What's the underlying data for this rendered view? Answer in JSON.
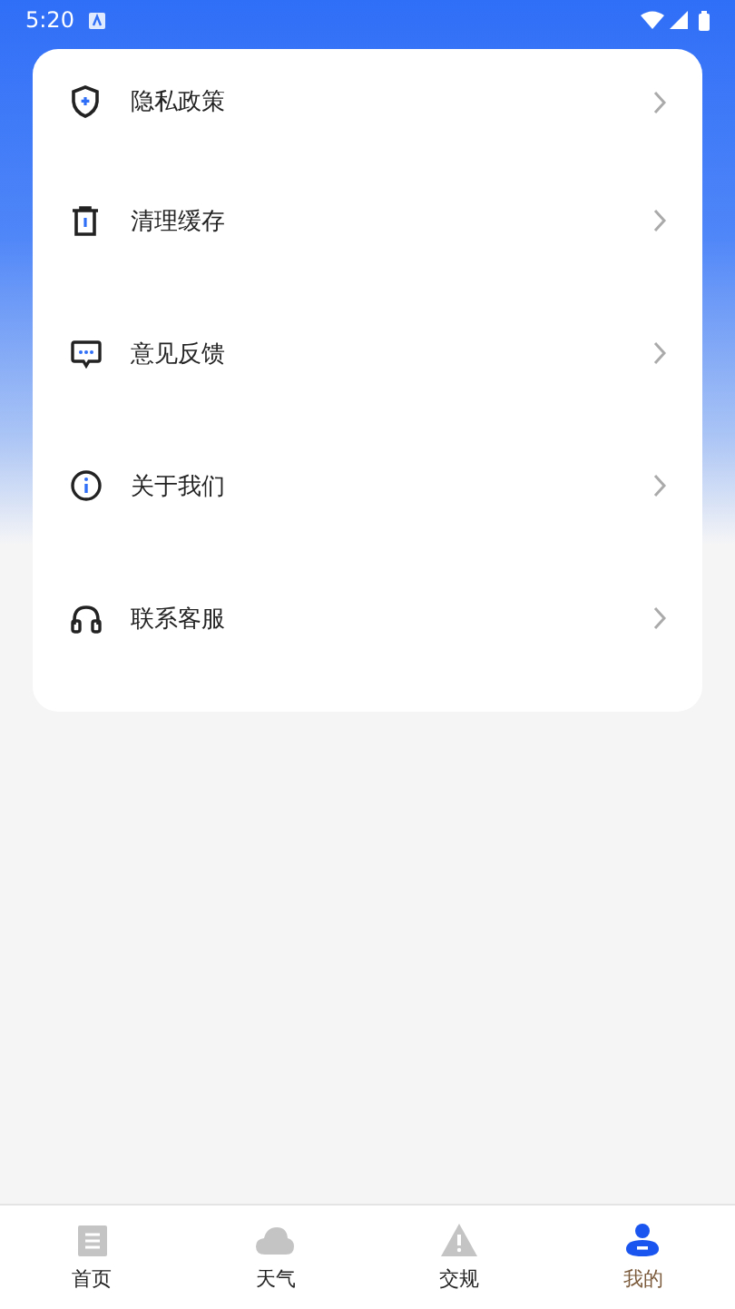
{
  "status_bar": {
    "time": "5:20"
  },
  "menu": {
    "items": [
      {
        "label": "隐私政策"
      },
      {
        "label": "清理缓存"
      },
      {
        "label": "意见反馈"
      },
      {
        "label": "关于我们"
      },
      {
        "label": "联系客服"
      }
    ]
  },
  "tab_bar": {
    "tabs": [
      {
        "label": "首页",
        "selected": false
      },
      {
        "label": "天气",
        "selected": false
      },
      {
        "label": "交规",
        "selected": false
      },
      {
        "label": "我的",
        "selected": true
      }
    ]
  }
}
